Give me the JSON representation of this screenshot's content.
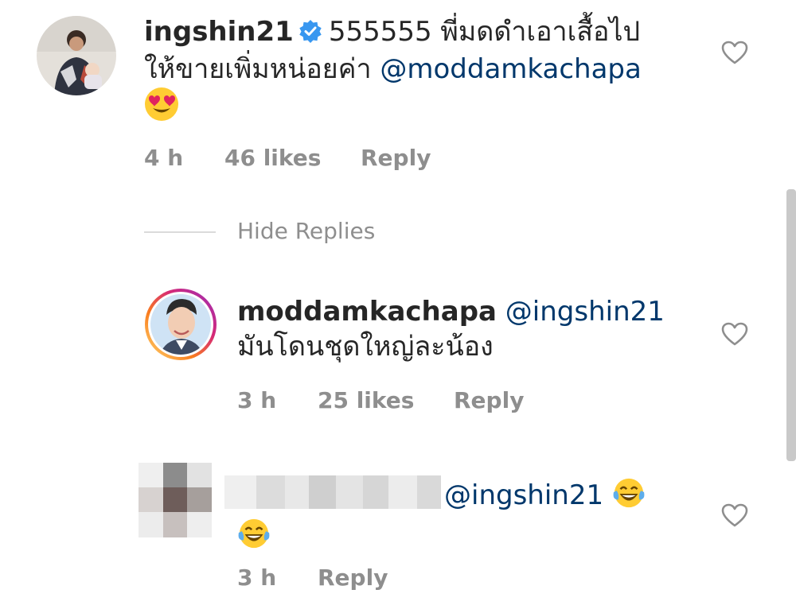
{
  "comments": [
    {
      "username": "ingshin21",
      "verified": true,
      "text_line1": "555555 พี่มดดำเอาเสื้อไป",
      "text_line2": "ให้ขายเพิ่มหน่อยค่า",
      "mention": "@moddamkachapa",
      "emoji": "heart-eyes-emoji",
      "time": "4 h",
      "likes": "46 likes",
      "reply_label": "Reply"
    }
  ],
  "hide_replies_label": "Hide Replies",
  "replies": [
    {
      "username": "moddamkachapa",
      "mention": "@ingshin21",
      "text": "มันโดนชุดใหญ่ละน้อง",
      "time": "3 h",
      "likes": "25 likes",
      "reply_label": "Reply"
    },
    {
      "username_blurred": true,
      "mention": "@ingshin21",
      "emoji": "tears-of-joy-emoji",
      "time": "3 h",
      "reply_label": "Reply"
    }
  ],
  "colors": {
    "text": "#262626",
    "secondary": "#8e8e8e",
    "mention": "#00376b",
    "verified": "#3897f0",
    "divider": "#dbdbdb"
  },
  "icons": [
    "verified-badge-icon",
    "heart-outline-icon"
  ]
}
